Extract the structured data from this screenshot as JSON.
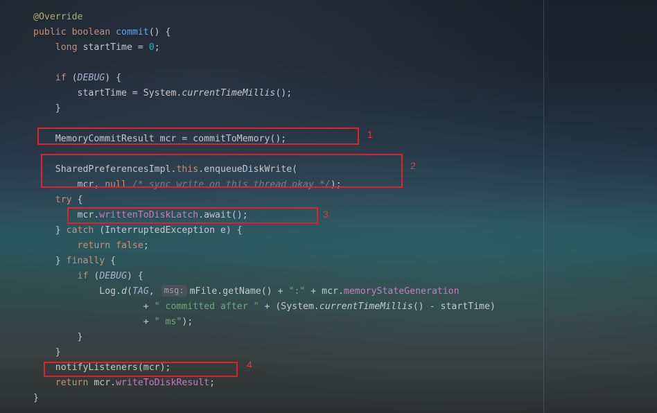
{
  "code": {
    "lines": [
      [
        {
          "t": "@Override",
          "c": "ann"
        }
      ],
      [
        {
          "t": "public boolean ",
          "c": "kw"
        },
        {
          "t": "commit",
          "c": "fn"
        },
        {
          "t": "() {"
        }
      ],
      [
        {
          "t": "    "
        },
        {
          "t": "long ",
          "c": "kw"
        },
        {
          "t": "startTime = "
        },
        {
          "t": "0",
          "c": "num"
        },
        {
          "t": ";"
        }
      ],
      [
        {
          "t": ""
        }
      ],
      [
        {
          "t": "    "
        },
        {
          "t": "if ",
          "c": "kw"
        },
        {
          "t": "("
        },
        {
          "t": "DEBUG",
          "c": "ital"
        },
        {
          "t": ") {"
        }
      ],
      [
        {
          "t": "        startTime = System."
        },
        {
          "t": "currentTimeMillis",
          "c": "it"
        },
        {
          "t": "();"
        }
      ],
      [
        {
          "t": "    }"
        }
      ],
      [
        {
          "t": ""
        }
      ],
      [
        {
          "t": "    MemoryCommitResult mcr = commitToMemory();"
        }
      ],
      [
        {
          "t": ""
        }
      ],
      [
        {
          "t": "    SharedPreferencesImpl."
        },
        {
          "t": "this",
          "c": "kw"
        },
        {
          "t": ".enqueueDiskWrite("
        }
      ],
      [
        {
          "t": "        mcr, "
        },
        {
          "t": "null ",
          "c": "kw"
        },
        {
          "t": "/* sync write on this thread okay */",
          "c": "cmt"
        },
        {
          "t": ");"
        }
      ],
      [
        {
          "t": "    "
        },
        {
          "t": "try ",
          "c": "kw"
        },
        {
          "t": "{"
        }
      ],
      [
        {
          "t": "        mcr."
        },
        {
          "t": "writtenToDiskLatch",
          "c": "fld"
        },
        {
          "t": ".await();"
        }
      ],
      [
        {
          "t": "    } "
        },
        {
          "t": "catch ",
          "c": "kw"
        },
        {
          "t": "(InterruptedException e) {"
        }
      ],
      [
        {
          "t": "        "
        },
        {
          "t": "return false",
          "c": "kw"
        },
        {
          "t": ";"
        }
      ],
      [
        {
          "t": "    } "
        },
        {
          "t": "finally ",
          "c": "kw"
        },
        {
          "t": "{"
        }
      ],
      [
        {
          "t": "        "
        },
        {
          "t": "if ",
          "c": "kw"
        },
        {
          "t": "("
        },
        {
          "t": "DEBUG",
          "c": "ital"
        },
        {
          "t": ") {"
        }
      ],
      [
        {
          "t": "            Log."
        },
        {
          "t": "d",
          "c": "it"
        },
        {
          "t": "("
        },
        {
          "t": "TAG",
          "c": "ital"
        },
        {
          "t": ", "
        },
        {
          "t": "msg:",
          "c": "hint"
        },
        {
          "t": "mFile.getName() + "
        },
        {
          "t": "\":\"",
          "c": "str"
        },
        {
          "t": " + mcr."
        },
        {
          "t": "memoryStateGeneration",
          "c": "fld"
        }
      ],
      [
        {
          "t": "                    + "
        },
        {
          "t": "\" committed after \"",
          "c": "str"
        },
        {
          "t": " + (System."
        },
        {
          "t": "currentTimeMillis",
          "c": "it"
        },
        {
          "t": "() - startTime)"
        }
      ],
      [
        {
          "t": "                    + "
        },
        {
          "t": "\" ms\"",
          "c": "str"
        },
        {
          "t": ");"
        }
      ],
      [
        {
          "t": "        }"
        }
      ],
      [
        {
          "t": "    }"
        }
      ],
      [
        {
          "t": "    notifyListeners(mcr);"
        }
      ],
      [
        {
          "t": "    "
        },
        {
          "t": "return ",
          "c": "kw"
        },
        {
          "t": "mcr."
        },
        {
          "t": "writeToDiskResult",
          "c": "fld"
        },
        {
          "t": ";"
        }
      ],
      [
        {
          "t": "}"
        }
      ]
    ]
  },
  "annotations": [
    {
      "label": "1"
    },
    {
      "label": "2"
    },
    {
      "label": "3"
    },
    {
      "label": "4"
    }
  ]
}
